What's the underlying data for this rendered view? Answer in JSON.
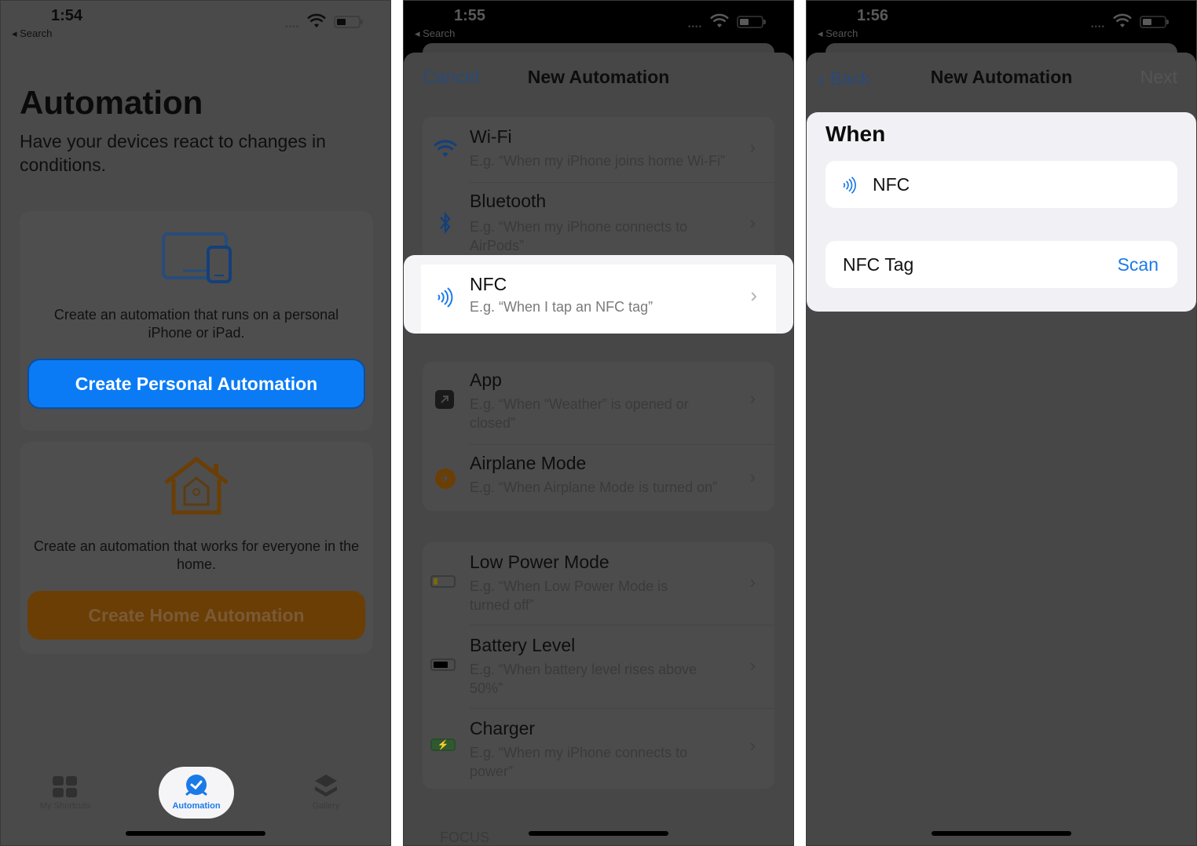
{
  "colors": {
    "accent_blue": "#0a7bf5",
    "home_orange": "#6a3e05",
    "link_blue": "#1a7ae8"
  },
  "panels": [
    {
      "status": {
        "time": "1:54",
        "back_label": "◂ Search",
        "battery_level": 0.35
      },
      "page_title": "Automation",
      "subtitle": "Have your devices react to changes in conditions.",
      "personal_card": {
        "icon": "devices-icon",
        "description": "Create an automation that runs on a personal iPhone or iPad.",
        "button_label": "Create Personal Automation"
      },
      "home_card": {
        "icon": "home-icon",
        "description": "Create an automation that works for everyone in the home.",
        "button_label": "Create Home Automation"
      },
      "tabbar": [
        {
          "label": "My Shortcuts",
          "icon": "grid-icon",
          "active": false
        },
        {
          "label": "Automation",
          "icon": "automation-clock-icon",
          "active": true
        },
        {
          "label": "Gallery",
          "icon": "layers-icon",
          "active": false
        }
      ]
    },
    {
      "status": {
        "time": "1:55",
        "back_label": "◂ Search",
        "battery_level": 0.35
      },
      "nav": {
        "left": "Cancel",
        "title": "New Automation"
      },
      "triggers": [
        {
          "title": "Wi-Fi",
          "subtitle": "E.g. “When my iPhone joins home Wi-Fi”",
          "icon": "wifi-icon"
        },
        {
          "title": "Bluetooth",
          "subtitle": "E.g. “When my iPhone connects to AirPods”",
          "icon": "bluetooth-icon"
        },
        {
          "title": "NFC",
          "subtitle": "E.g. “When I tap an NFC tag”",
          "icon": "nfc-icon",
          "highlighted": true
        },
        {
          "title": "App",
          "subtitle": "E.g. “When “Weather” is opened or closed”",
          "icon": "app-icon"
        },
        {
          "title": "Airplane Mode",
          "subtitle": "E.g. “When Airplane Mode is turned on”",
          "icon": "airplane-icon"
        },
        {
          "title": "Low Power Mode",
          "subtitle": "E.g. “When Low Power Mode is turned off”",
          "icon": "low-power-battery-icon"
        },
        {
          "title": "Battery Level",
          "subtitle": "E.g. “When battery level rises above 50%”",
          "icon": "battery-icon"
        },
        {
          "title": "Charger",
          "subtitle": "E.g. “When my iPhone connects to power”",
          "icon": "charger-icon"
        }
      ],
      "section_focus": "FOCUS"
    },
    {
      "status": {
        "time": "1:56",
        "back_label": "◂ Search",
        "battery_level": 0.35
      },
      "nav": {
        "left": "Back",
        "title": "New Automation",
        "right": "Next"
      },
      "when_title": "When",
      "trigger_label": "NFC",
      "tag_label": "NFC Tag",
      "scan_label": "Scan"
    }
  ]
}
